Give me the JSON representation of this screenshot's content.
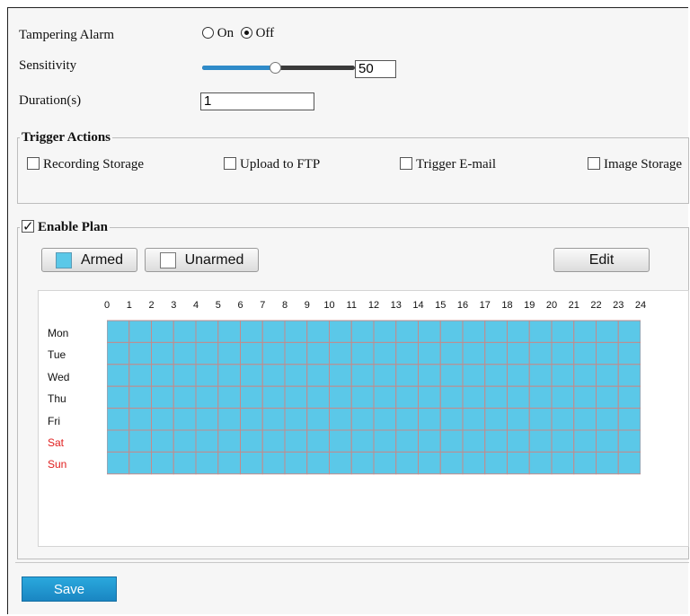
{
  "tampering": {
    "label": "Tampering Alarm",
    "on_label": "On",
    "off_label": "Off",
    "selected": "Off"
  },
  "sensitivity": {
    "label": "Sensitivity",
    "value": "50",
    "level": 50
  },
  "duration": {
    "label": "Duration(s)",
    "value": "1"
  },
  "trigger_actions": {
    "legend": "Trigger Actions",
    "items": [
      {
        "label": "Recording Storage",
        "checked": false
      },
      {
        "label": "Upload to FTP",
        "checked": false
      },
      {
        "label": "Trigger E-mail",
        "checked": false
      },
      {
        "label": "Image Storage",
        "checked": false
      }
    ]
  },
  "plan": {
    "legend": "Enable Plan",
    "enabled": true,
    "armed_label": "Armed",
    "unarmed_label": "Unarmed",
    "edit_label": "Edit",
    "armed_color": "#5bc8e8",
    "grid_line_color": "#c48a8a",
    "hours": [
      "0",
      "1",
      "2",
      "3",
      "4",
      "5",
      "6",
      "7",
      "8",
      "9",
      "10",
      "11",
      "12",
      "13",
      "14",
      "15",
      "16",
      "17",
      "18",
      "19",
      "20",
      "21",
      "22",
      "23",
      "24"
    ],
    "days": [
      {
        "label": "Mon",
        "weekend": false
      },
      {
        "label": "Tue",
        "weekend": false
      },
      {
        "label": "Wed",
        "weekend": false
      },
      {
        "label": "Thu",
        "weekend": false
      },
      {
        "label": "Fri",
        "weekend": false
      },
      {
        "label": "Sat",
        "weekend": true
      },
      {
        "label": "Sun",
        "weekend": true
      }
    ]
  },
  "save_label": "Save",
  "colors": {
    "save_button": "#1f95d0",
    "slider_fill": "#2f8bc9",
    "weekend_text": "#e01d1d"
  }
}
